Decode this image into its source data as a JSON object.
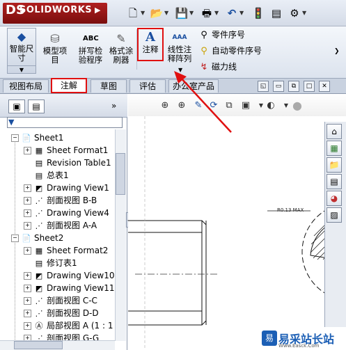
{
  "app": {
    "logo_mark": "DS",
    "logo_text": "SOLIDWORKS",
    "logo_arrow": "▶"
  },
  "quick_access": [
    {
      "icon": "new-document-icon",
      "glyph": "🗋"
    },
    {
      "icon": "open-folder-icon",
      "glyph": "📂"
    },
    {
      "icon": "save-icon",
      "glyph": "💾"
    },
    {
      "icon": "print-icon",
      "glyph": "🖶"
    },
    {
      "icon": "undo-icon",
      "glyph": "↶"
    },
    {
      "icon": "rebuild-icon",
      "glyph": "🚦"
    },
    {
      "icon": "file-properties-icon",
      "glyph": "▤"
    },
    {
      "icon": "options-icon",
      "glyph": "⚙"
    }
  ],
  "ribbon": {
    "smart_dimension": "智能尺寸",
    "model_items": "模型项目",
    "spell_check": "拼写检验程序",
    "format_painter": "格式涂刷器",
    "annotation": "注释",
    "linear_note_pattern": "线性注释阵列",
    "side_items": [
      "零件序号",
      "自动零件序号",
      "磁力线"
    ],
    "icons": {
      "smart_dimension": "◆",
      "model_items": "⛁",
      "spell_check": "ABC",
      "format_painter": "✎",
      "annotation": "A",
      "linear_note_pattern": "AAA",
      "balloon": "⚲",
      "auto_balloon": "⚲",
      "magnetic_line": "↯"
    }
  },
  "tabs": [
    "视图布局",
    "注解",
    "草图",
    "评估",
    "办公室产品"
  ],
  "active_tab": "注解",
  "tree": {
    "expand_button": "»",
    "items": [
      {
        "label": "Sheet1",
        "level": 0,
        "expander": "−",
        "icon": "📄"
      },
      {
        "label": "Sheet Format1",
        "level": 1,
        "expander": "+",
        "icon": "▦"
      },
      {
        "label": "Revision Table1",
        "level": 1,
        "expander": "",
        "icon": "▤"
      },
      {
        "label": "总表1",
        "level": 1,
        "expander": "",
        "icon": "▤"
      },
      {
        "label": "Drawing View1",
        "level": 1,
        "expander": "+",
        "icon": "◩"
      },
      {
        "label": "剖面视图 B-B",
        "level": 1,
        "expander": "+",
        "icon": "⋰"
      },
      {
        "label": "Drawing View4",
        "level": 1,
        "expander": "+",
        "icon": "⋰"
      },
      {
        "label": "剖面视图 A-A",
        "level": 1,
        "expander": "+",
        "icon": "⋰"
      },
      {
        "label": "Sheet2",
        "level": 0,
        "expander": "−",
        "icon": "📄"
      },
      {
        "label": "Sheet Format2",
        "level": 1,
        "expander": "+",
        "icon": "▦"
      },
      {
        "label": "修订表1",
        "level": 1,
        "expander": "",
        "icon": "▤"
      },
      {
        "label": "Drawing View10",
        "level": 1,
        "expander": "+",
        "icon": "◩"
      },
      {
        "label": "Drawing View11",
        "level": 1,
        "expander": "+",
        "icon": "◩"
      },
      {
        "label": "剖面视图 C-C",
        "level": 1,
        "expander": "+",
        "icon": "⋰"
      },
      {
        "label": "剖面视图 D-D",
        "level": 1,
        "expander": "+",
        "icon": "⋰"
      },
      {
        "label": "局部视图 A (1 : 1",
        "level": 1,
        "expander": "+",
        "icon": "Ⓐ"
      },
      {
        "label": "剖面视图 G-G",
        "level": 1,
        "expander": "+",
        "icon": "⋰"
      }
    ]
  },
  "view_toolbar": [
    "⊕",
    "⊕",
    "✎",
    "⟳",
    "⧉",
    "▣",
    "◐",
    "⛭",
    "●"
  ],
  "drawing": {
    "dimension_text": "R0.13 MAX"
  },
  "task_pane_icons": [
    "⌂",
    "▦",
    "📁",
    "▤",
    "◕",
    "▨"
  ],
  "watermark": {
    "icon": "易",
    "text": "易采站长站",
    "url": "Www.Easck.Com"
  },
  "colors": {
    "highlight": "#e01010",
    "brand": "#9a1414",
    "arrow": "#e01010"
  }
}
